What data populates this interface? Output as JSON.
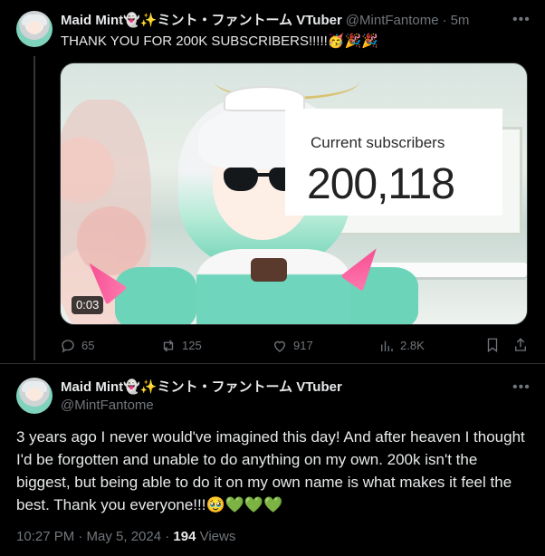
{
  "tweet1": {
    "display_name": "Maid Mint👻✨ミント・ファントーム VTuber",
    "handle": "@MintFantome",
    "time_sep": "·",
    "time": "5m",
    "text": "THANK YOU FOR 200K SUBSCRIBERS!!!!!🥳🎉🎉",
    "media": {
      "counter_label": "Current subscribers",
      "counter_value": "200,118",
      "duration": "0:03"
    },
    "actions": {
      "replies": "65",
      "reposts": "125",
      "likes": "917",
      "views": "2.8K"
    }
  },
  "tweet2": {
    "display_name": "Maid Mint👻✨ミント・ファントーム VTuber",
    "handle": "@MintFantome",
    "text": "3 years ago I never would've imagined this day! And after heaven I thought I'd be forgotten and unable to do anything on my own. 200k isn't the biggest, but being able to do it on my own name is what makes it feel the best. Thank you everyone!!!🥹💚💚💚",
    "timestamp": "10:27 PM · May 5, 2024 · ",
    "views_count": "194",
    "views_label": " Views"
  },
  "icons": {
    "more": "more-horizontal-icon",
    "reply": "reply-icon",
    "repost": "repost-icon",
    "like": "heart-icon",
    "views": "bar-chart-icon",
    "bookmark": "bookmark-icon",
    "share": "share-icon"
  },
  "colors": {
    "background": "#000000",
    "text": "#e7e9ea",
    "secondary": "#71767b",
    "divider": "#2f3336"
  }
}
